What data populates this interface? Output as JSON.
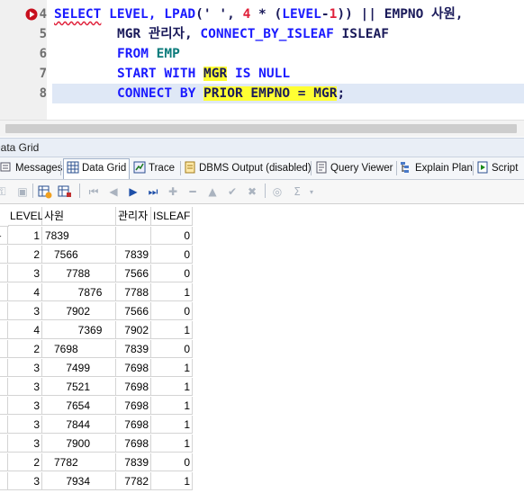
{
  "editor": {
    "lines": [
      {
        "num": "4"
      },
      {
        "num": "5"
      },
      {
        "num": "6"
      },
      {
        "num": "7"
      },
      {
        "num": "8"
      }
    ],
    "tokens": {
      "l4_select": "SELECT",
      "l4_level": " LEVEL, ",
      "l4_lpad": "LPAD",
      "l4_open": "(",
      "l4_str": "' '",
      "l4_comma": ", ",
      "l4_four": "4",
      "l4_mul": " * (",
      "l4_level2": "LEVEL",
      "l4_minus": "-",
      "l4_one": "1",
      "l4_close": ")) || ",
      "l4_empno": "EMPNO 사원,",
      "l5_mgr": "MGR 관리자, ",
      "l5_cbi": "CONNECT_BY_ISLEAF",
      "l5_isleaf": " ISLEAF",
      "l6_from": "FROM ",
      "l6_emp": "EMP",
      "l7_start": "START WITH ",
      "l7_mgr": "MGR",
      "l7_isnull": " IS NULL",
      "l8_connect": "CONNECT BY ",
      "l8_prior": "PRIOR EMPNO = MGR",
      "l8_semi": ";"
    }
  },
  "panel": {
    "title": "Data Grid",
    "tabs": [
      {
        "label": "Messages",
        "icon": "messages-icon"
      },
      {
        "label": "Data Grid",
        "icon": "data-grid-icon"
      },
      {
        "label": "Trace",
        "icon": "trace-icon"
      },
      {
        "label": "DBMS Output (disabled)",
        "icon": "dbms-output-icon"
      },
      {
        "label": "Query Viewer",
        "icon": "query-viewer-icon"
      },
      {
        "label": "Explain Plan",
        "icon": "explain-plan-icon"
      },
      {
        "label": "Script",
        "icon": "script-icon"
      }
    ],
    "active_tab": "Data Grid"
  },
  "grid": {
    "columns": [
      "LEVEL",
      "사원",
      "관리자",
      "ISLEAF"
    ],
    "rows": [
      {
        "level": "1",
        "emp": "7839",
        "mgr": "",
        "isleaf": "0"
      },
      {
        "level": "2",
        "emp": "   7566",
        "mgr": "7839",
        "isleaf": "0"
      },
      {
        "level": "3",
        "emp": "       7788",
        "mgr": "7566",
        "isleaf": "0"
      },
      {
        "level": "4",
        "emp": "           7876",
        "mgr": "7788",
        "isleaf": "1"
      },
      {
        "level": "3",
        "emp": "       7902",
        "mgr": "7566",
        "isleaf": "0"
      },
      {
        "level": "4",
        "emp": "           7369",
        "mgr": "7902",
        "isleaf": "1"
      },
      {
        "level": "2",
        "emp": "   7698",
        "mgr": "7839",
        "isleaf": "0"
      },
      {
        "level": "3",
        "emp": "       7499",
        "mgr": "7698",
        "isleaf": "1"
      },
      {
        "level": "3",
        "emp": "       7521",
        "mgr": "7698",
        "isleaf": "1"
      },
      {
        "level": "3",
        "emp": "       7654",
        "mgr": "7698",
        "isleaf": "1"
      },
      {
        "level": "3",
        "emp": "       7844",
        "mgr": "7698",
        "isleaf": "1"
      },
      {
        "level": "3",
        "emp": "       7900",
        "mgr": "7698",
        "isleaf": "1"
      },
      {
        "level": "2",
        "emp": "   7782",
        "mgr": "7839",
        "isleaf": "0"
      },
      {
        "level": "3",
        "emp": "       7934",
        "mgr": "7782",
        "isleaf": "1"
      }
    ]
  },
  "colors": {
    "keyword": "#1a1aff",
    "number": "#e0203a",
    "highlight": "#ffff33",
    "current_line": "#dfe8f6"
  }
}
